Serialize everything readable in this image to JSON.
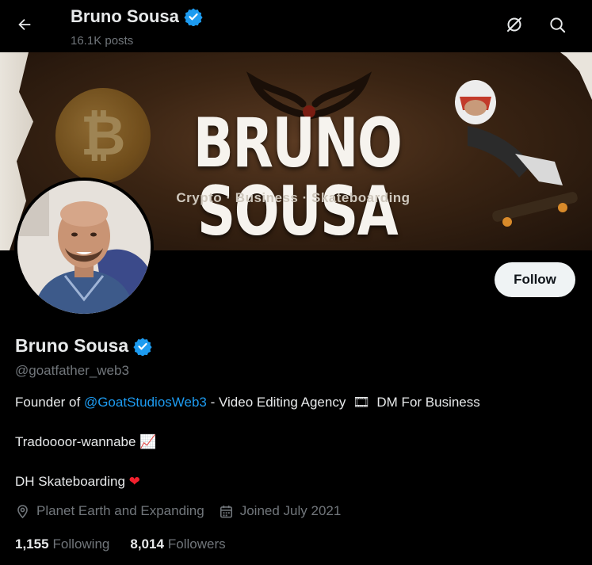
{
  "header": {
    "title": "Bruno Sousa",
    "posts_count": "16.1K posts"
  },
  "banner": {
    "title": "BRUNO SOUSA",
    "tagline": "Crypto · Business · Skateboarding"
  },
  "profile": {
    "display_name": "Bruno Sousa",
    "handle": "@goatfather_web3",
    "follow_label": "Follow",
    "bio": {
      "line1_prefix": "Founder of ",
      "line1_mention": "@GoatStudiosWeb3",
      "line1_suffix": " - Video Editing Agency ",
      "line1_emoji": "🎞",
      "line1_end": " DM For Business",
      "line2_text": "Tradoooor-wannabe ",
      "line2_emoji": "📈",
      "line3_text": "DH Skateboarding ",
      "line3_emoji": "❤"
    },
    "location": "Planet Earth and Expanding",
    "joined": "Joined July 2021",
    "following_count": "1,155",
    "following_label": "Following",
    "followers_count": "8,014",
    "followers_label": "Followers"
  },
  "colors": {
    "accent": "#1d9bf0",
    "verified": "#1d9bf0",
    "text_primary": "#e7e9ea",
    "text_secondary": "#71767b",
    "background": "#000000"
  },
  "icons": {
    "back": "arrow-left-icon",
    "hide": "eye-slash-icon",
    "search": "search-icon",
    "verified": "verified-badge-icon",
    "location": "location-pin-icon",
    "calendar": "calendar-icon"
  }
}
